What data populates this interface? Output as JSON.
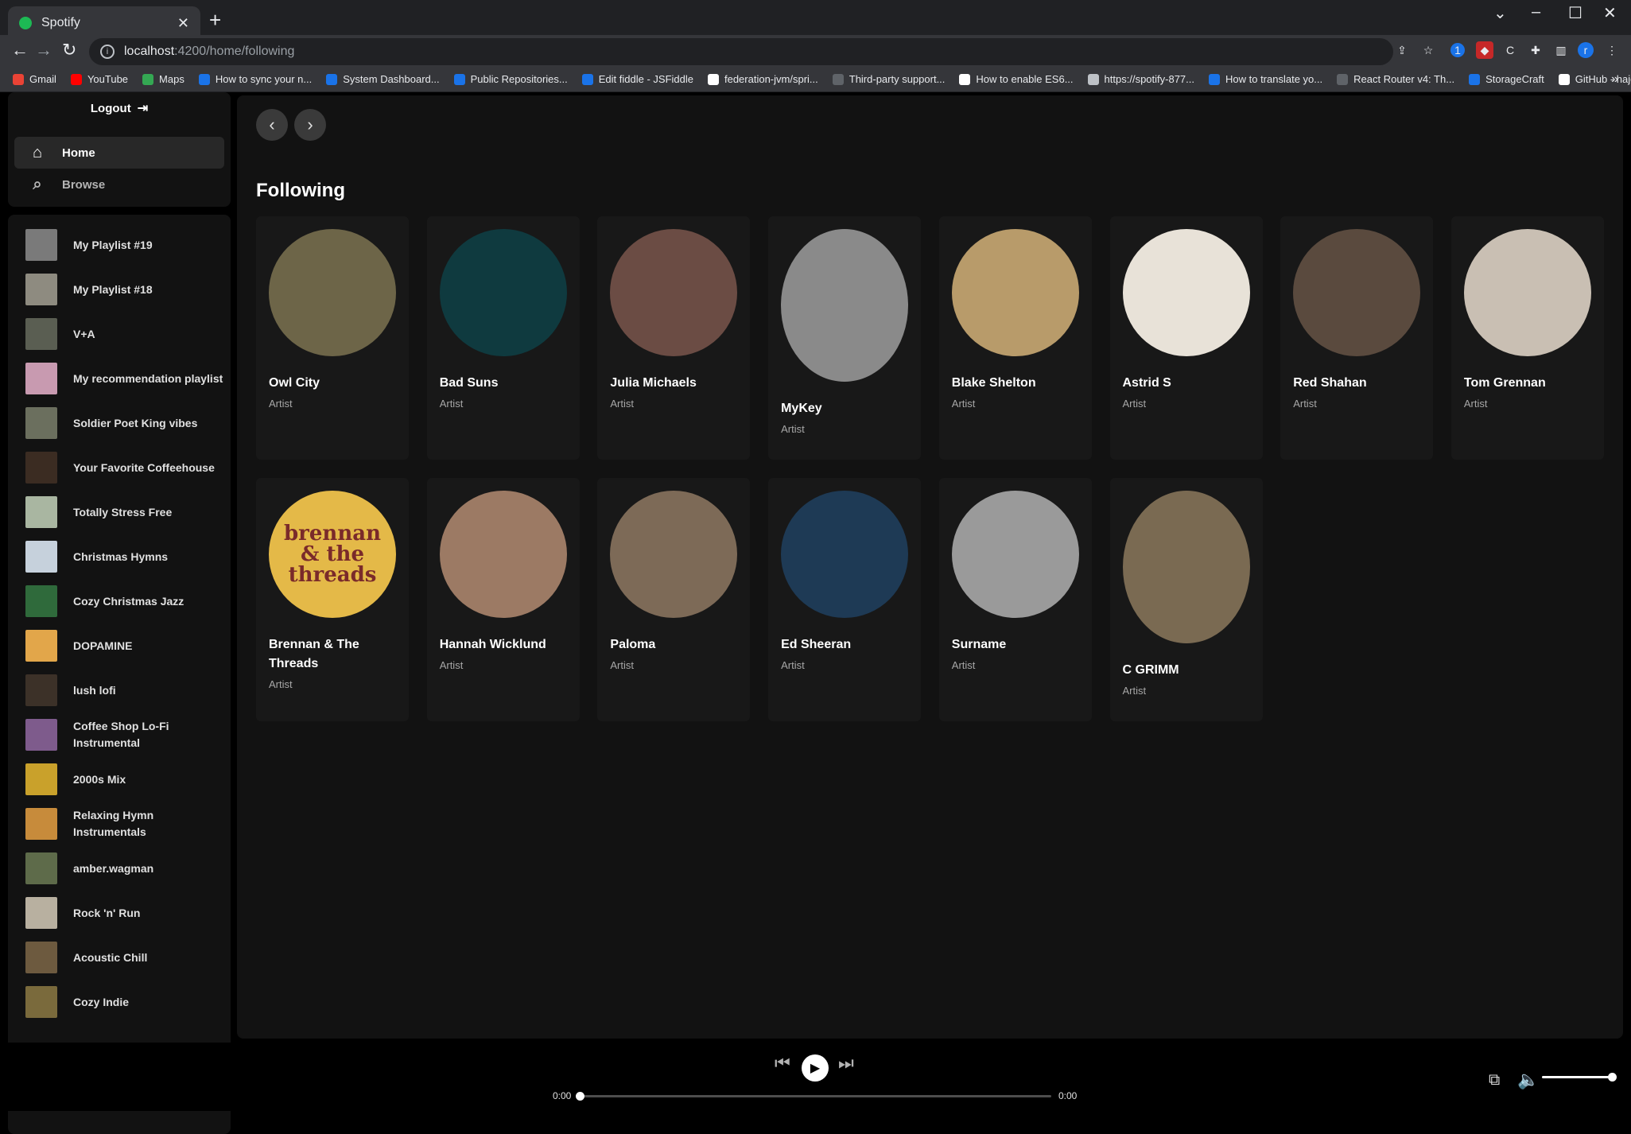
{
  "browser": {
    "tab_title": "Spotify",
    "url_host": "localhost",
    "url_path": ":4200/home/following",
    "bookmarks": [
      "Gmail",
      "YouTube",
      "Maps",
      "How to sync your n...",
      "System Dashboard...",
      "Public Repositories...",
      "Edit fiddle - JSFiddle",
      "federation-jvm/spri...",
      "Third-party support...",
      "How to enable ES6...",
      "https://spotify-877...",
      "How to translate yo...",
      "React Router v4: Th...",
      "StorageCraft",
      "GitHub - hajocava/..."
    ],
    "bookmark_colors": [
      "#ea4335",
      "#ff0000",
      "#34a853",
      "#1a73e8",
      "#1a73e8",
      "#1a73e8",
      "#1a73e8",
      "#ffffff",
      "#5f6368",
      "#ffffff",
      "#bdc1c6",
      "#1a73e8",
      "#5f6368",
      "#1a73e8",
      "#ffffff"
    ]
  },
  "sidebar": {
    "logout_label": "Logout",
    "nav": [
      {
        "label": "Home",
        "icon": "home-icon",
        "active": true
      },
      {
        "label": "Browse",
        "icon": "search-icon",
        "active": false
      }
    ],
    "playlists": [
      {
        "name": "My Playlist #19",
        "color": "#7a7a7a"
      },
      {
        "name": "My Playlist #18",
        "color": "#8e8b80"
      },
      {
        "name": "V+A",
        "color": "#5a5e52"
      },
      {
        "name": "My recommendation playlist",
        "color": "#c89ab0"
      },
      {
        "name": "Soldier Poet King vibes",
        "color": "#6b6f5e"
      },
      {
        "name": "Your Favorite Coffeehouse",
        "color": "#3b2c22"
      },
      {
        "name": "Totally Stress Free",
        "color": "#a9b6a1"
      },
      {
        "name": "Christmas Hymns",
        "color": "#c6d1dc"
      },
      {
        "name": "Cozy Christmas Jazz",
        "color": "#2f6a3b"
      },
      {
        "name": "DOPAMINE",
        "color": "#e2a64a"
      },
      {
        "name": "lush lofi",
        "color": "#3c3128"
      },
      {
        "name": "Coffee Shop Lo-Fi Instrumental",
        "color": "#7e5b8c"
      },
      {
        "name": "2000s Mix",
        "color": "#c9a12b"
      },
      {
        "name": "Relaxing Hymn Instrumentals",
        "color": "#c78b3b"
      },
      {
        "name": "amber.wagman",
        "color": "#5e6b4a"
      },
      {
        "name": "Rock 'n' Run",
        "color": "#b8b0a0"
      },
      {
        "name": "Acoustic Chill",
        "color": "#6d5a3f"
      },
      {
        "name": "Cozy Indie",
        "color": "#7a6a3c"
      }
    ]
  },
  "main": {
    "heading": "Following",
    "artists": [
      {
        "name": "Owl City",
        "type": "Artist",
        "color": "#6d6548"
      },
      {
        "name": "Bad Suns",
        "type": "Artist",
        "color": "#0f3a3f"
      },
      {
        "name": "Julia Michaels",
        "type": "Artist",
        "color": "#6b4c44"
      },
      {
        "name": "MyKey",
        "type": "Artist",
        "color": "#8a8a8a"
      },
      {
        "name": "Blake Shelton",
        "type": "Artist",
        "color": "#b89b6a"
      },
      {
        "name": "Astrid S",
        "type": "Artist",
        "color": "#e8e2d8"
      },
      {
        "name": "Red Shahan",
        "type": "Artist",
        "color": "#5a4a3e"
      },
      {
        "name": "Tom Grennan",
        "type": "Artist",
        "color": "#c9bfb3"
      },
      {
        "name": "Brennan & The Threads",
        "type": "Artist",
        "color": "#e4b948",
        "logo_text": "brennan & the threads"
      },
      {
        "name": "Hannah Wicklund",
        "type": "Artist",
        "color": "#9c7a64"
      },
      {
        "name": "Paloma",
        "type": "Artist",
        "color": "#7d6a57"
      },
      {
        "name": "Ed Sheeran",
        "type": "Artist",
        "color": "#1e3a55"
      },
      {
        "name": "Surname",
        "type": "Artist",
        "color": "#9a9a9a"
      },
      {
        "name": "C GRIMM",
        "type": "Artist",
        "color": "#7a6a52"
      }
    ]
  },
  "player": {
    "elapsed": "0:00",
    "duration": "0:00",
    "progress_fraction": 0.0,
    "volume_fraction": 1.0
  }
}
